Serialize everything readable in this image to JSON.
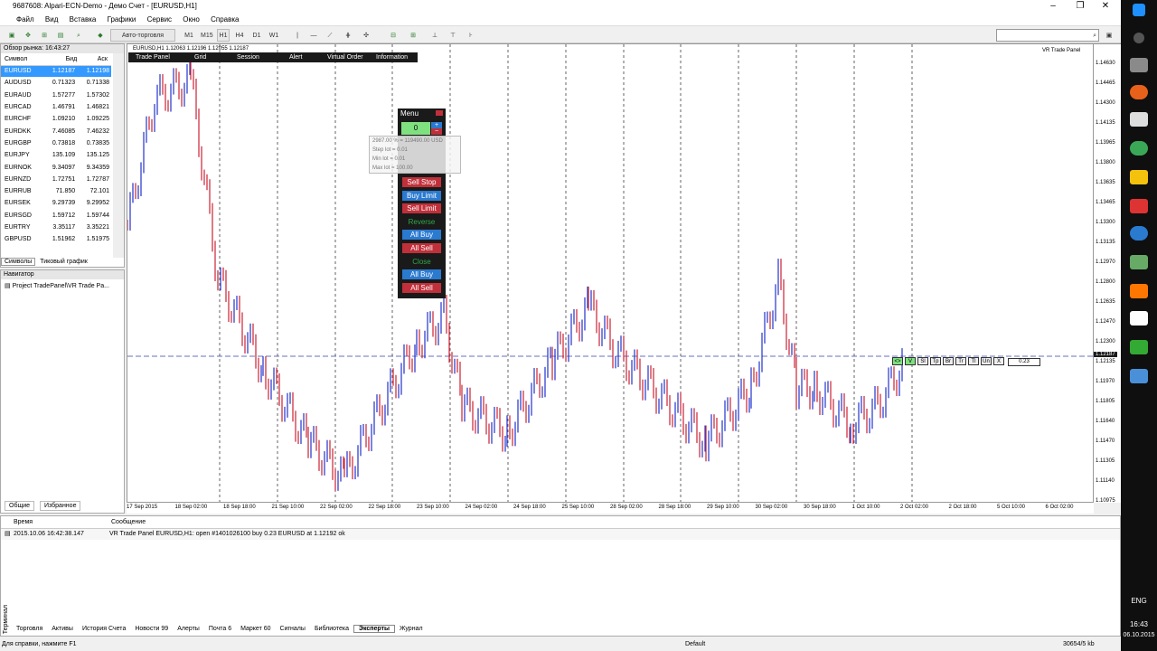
{
  "window": {
    "title": "9687608: Alpari-ECN-Demo - Демо Счет - [EURUSD,H1]"
  },
  "menu": [
    "Файл",
    "Вид",
    "Вставка",
    "Графики",
    "Сервис",
    "Окно",
    "Справка"
  ],
  "toolbar": {
    "autotrade_label": "Авто-торговля",
    "timeframes": [
      "M1",
      "M15",
      "H1",
      "H4",
      "D1",
      "W1"
    ]
  },
  "market_watch": {
    "title": "Обзор рынка: 16:43:27",
    "columns": [
      "Символ",
      "Бид",
      "Аск"
    ],
    "rows": [
      {
        "symbol": "EURUSD",
        "bid": "1.12187",
        "ask": "1.12198"
      },
      {
        "symbol": "AUDUSD",
        "bid": "0.71323",
        "ask": "0.71338"
      },
      {
        "symbol": "EURAUD",
        "bid": "1.57277",
        "ask": "1.57302"
      },
      {
        "symbol": "EURCAD",
        "bid": "1.46791",
        "ask": "1.46821"
      },
      {
        "symbol": "EURCHF",
        "bid": "1.09210",
        "ask": "1.09225"
      },
      {
        "symbol": "EURDKK",
        "bid": "7.46085",
        "ask": "7.46232"
      },
      {
        "symbol": "EURGBP",
        "bid": "0.73818",
        "ask": "0.73835"
      },
      {
        "symbol": "EURJPY",
        "bid": "135.109",
        "ask": "135.125"
      },
      {
        "symbol": "EURNOK",
        "bid": "9.34097",
        "ask": "9.34359"
      },
      {
        "symbol": "EURNZD",
        "bid": "1.72751",
        "ask": "1.72787"
      },
      {
        "symbol": "EURRUB",
        "bid": "71.850",
        "ask": "72.101"
      },
      {
        "symbol": "EURSEK",
        "bid": "9.29739",
        "ask": "9.29952"
      },
      {
        "symbol": "EURSGD",
        "bid": "1.59712",
        "ask": "1.59744"
      },
      {
        "symbol": "EURTRY",
        "bid": "3.35117",
        "ask": "3.35221"
      },
      {
        "symbol": "GBPUSD",
        "bid": "1.51962",
        "ask": "1.51975"
      }
    ],
    "tabs": [
      "Символы",
      "Тиковый график"
    ]
  },
  "navigator": {
    "title": "Навигатор",
    "item": "Project TradePanel\\VR Trade Pa...",
    "tabs": [
      "Общие",
      "Избранное"
    ]
  },
  "chart": {
    "header": "EURUSD,H1  1.12063 1.12196 1.12055 1.12187",
    "indicator_label": "VR Trade Panel",
    "price_labels": [
      "1.14630",
      "1.14465",
      "1.14300",
      "1.14135",
      "1.13965",
      "1.13800",
      "1.13635",
      "1.13465",
      "1.13300",
      "1.13135",
      "1.12970",
      "1.12800",
      "1.12635",
      "1.12470",
      "1.12300",
      "1.12135",
      "1.11970",
      "1.11805",
      "1.11640",
      "1.11470",
      "1.11305",
      "1.11140",
      "1.10975"
    ],
    "current_price": "1.12187",
    "time_labels": [
      "17 Sep 2015",
      "18 Sep 02:00",
      "18 Sep 18:00",
      "21 Sep 10:00",
      "22 Sep 02:00",
      "22 Sep 18:00",
      "23 Sep 10:00",
      "24 Sep 02:00",
      "24 Sep 18:00",
      "25 Sep 10:00",
      "28 Sep 02:00",
      "28 Sep 18:00",
      "29 Sep 10:00",
      "30 Sep 02:00",
      "30 Sep 18:00",
      "1 Oct 10:00",
      "2 Oct 02:00",
      "2 Oct 18:00",
      "5 Oct 10:00",
      "6 Oct 02:00"
    ],
    "line_label": "0.23",
    "line_buttons": [
      "<>",
      "V",
      "Sl",
      "Tp",
      "Br",
      "Tr",
      "Tl",
      "Un",
      "X"
    ]
  },
  "trade_panel_menu": [
    "Trade Panel",
    "Grid",
    "Session",
    "Alert",
    "Virtual Order",
    "Information"
  ],
  "panel": {
    "title": "Menu",
    "lot_value": "0",
    "buttons": [
      {
        "label": "Sell Stop",
        "style": "red"
      },
      {
        "label": "Buy Limit",
        "style": "blue"
      },
      {
        "label": "Sell Limit",
        "style": "red"
      },
      {
        "label": "Reverse",
        "style": "green"
      },
      {
        "label": "All Buy",
        "style": "blue"
      },
      {
        "label": "All Sell",
        "style": "red"
      },
      {
        "label": "Close",
        "style": "green"
      },
      {
        "label": "All Buy",
        "style": "blue"
      },
      {
        "label": "All Sell",
        "style": "red"
      }
    ],
    "tooltip": [
      "2987.00 % = 119490.00 USD",
      "Step lot = 0.01",
      "Min lot = 0.01",
      "Max lot = 100.00"
    ]
  },
  "terminal": {
    "columns": [
      "Время",
      "Сообщение"
    ],
    "rows": [
      {
        "time": "2015.10.06 16:42:38.147",
        "message": "VR Trade Panel EURUSD,H1: open #1401026100 buy 0.23 EURUSD at 1.12192 ok"
      }
    ],
    "tabs": [
      "Торговля",
      "Активы",
      "История Счета",
      "Новости 99",
      "Алерты",
      "Почта 6",
      "Маркет 60",
      "Сигналы",
      "Библиотека",
      "Эксперты",
      "Журнал"
    ],
    "active_tab": "Эксперты",
    "side_label": "Терминал"
  },
  "statusbar": {
    "help": "Для справки, нажмите F1",
    "profile": "Default",
    "traffic": "30654/5 kb"
  },
  "taskbar": {
    "lang": "ENG",
    "time": "16:43",
    "date": "06.10.2015"
  }
}
